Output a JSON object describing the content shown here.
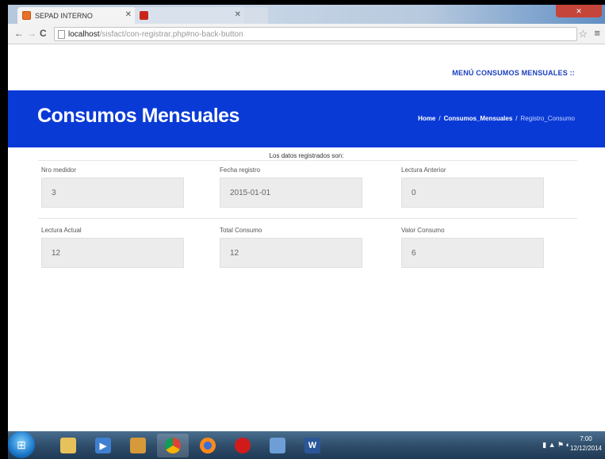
{
  "browser": {
    "tabs": [
      {
        "label": "SEPAD INTERNO"
      },
      {
        "label": ""
      },
      {
        "label": ""
      }
    ],
    "url_host": "localhost",
    "url_path": "/sisfact/con-registrar.php#no-back-button"
  },
  "page": {
    "top_menu": "MENÚ CONSUMOS MENSUALES ::",
    "title": "Consumos Mensuales",
    "breadcrumb": {
      "home": "Home",
      "sep1": "/",
      "section": "Consumos_Mensuales",
      "sep2": "/",
      "current": "Registro_Consumo"
    },
    "form_header": "Los datos registrados son:",
    "fields": [
      {
        "label": "Nro medidor",
        "value": "3"
      },
      {
        "label": "Fecha registro",
        "value": "2015-01-01"
      },
      {
        "label": "Lectura Anterior",
        "value": "0"
      },
      {
        "label": "Lectura Actual",
        "value": "12"
      },
      {
        "label": "Total Consumo",
        "value": "12"
      },
      {
        "label": "Valor Consumo",
        "value": "6"
      }
    ]
  },
  "taskbar": {
    "clock_time": "7:00",
    "clock_date": "12/12/2014",
    "word_glyph": "W"
  },
  "colors": {
    "banner": "#0a3ad6",
    "menu_text": "#1a3fbf",
    "field_bg": "#ececec"
  }
}
